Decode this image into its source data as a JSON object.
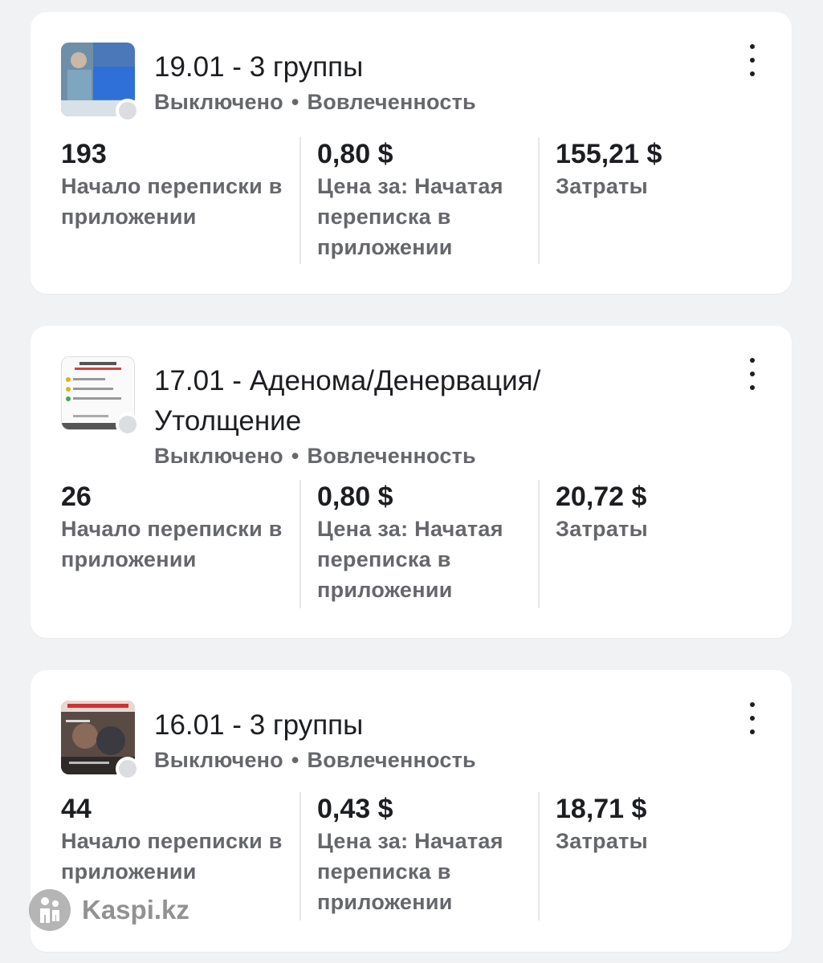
{
  "campaigns": [
    {
      "title": "19.01 - 3 группы",
      "status": "Выключено",
      "separator": "•",
      "objective": "Вовлеченность",
      "metrics": [
        {
          "value": "193",
          "label": "Начало переписки в приложении"
        },
        {
          "value": "0,80 $",
          "label": "Цена за: Начатая переписка в приложении"
        },
        {
          "value": "155,21 $",
          "label": "Затраты"
        }
      ]
    },
    {
      "title": "17.01 - Аденома/Денервация/ Утолщение",
      "status": "Выключено",
      "separator": "•",
      "objective": "Вовлеченность",
      "metrics": [
        {
          "value": "26",
          "label": "Начало переписки в приложении"
        },
        {
          "value": "0,80 $",
          "label": "Цена за: Начатая переписка в приложении"
        },
        {
          "value": "20,72 $",
          "label": "Затраты"
        }
      ]
    },
    {
      "title": "16.01 - 3 группы",
      "status": "Выключено",
      "separator": "•",
      "objective": "Вовлеченность",
      "metrics": [
        {
          "value": "44",
          "label": "Начало переписки в приложении"
        },
        {
          "value": "0,43 $",
          "label": "Цена за: Начатая переписка в приложении"
        },
        {
          "value": "18,71 $",
          "label": "Затраты"
        }
      ]
    }
  ],
  "watermark": {
    "text": "Kaspi.kz"
  },
  "icons": {
    "menu": "more-vertical-icon",
    "status": "status-off-dot-icon"
  },
  "colors": {
    "title": "#1c1e21",
    "secondary": "#65676b",
    "background": "#f1f2f4",
    "card": "#ffffff"
  }
}
